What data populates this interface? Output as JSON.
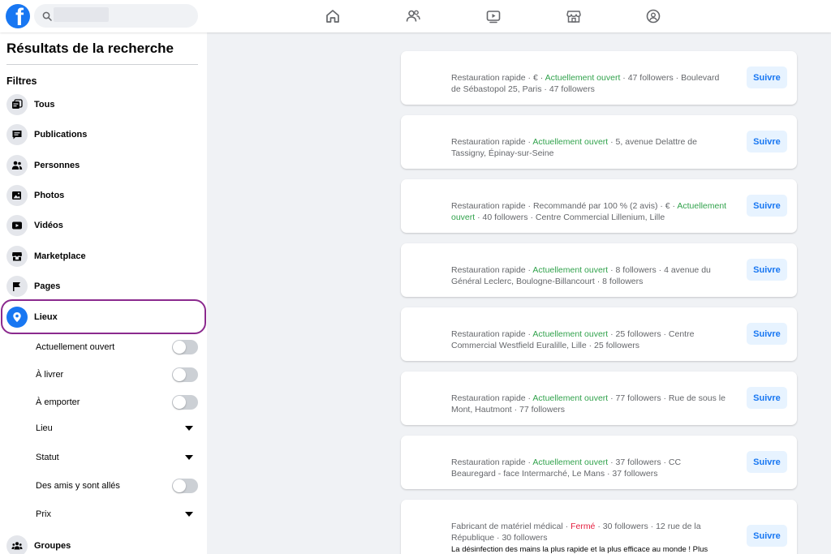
{
  "topbar": {
    "logo_letter": "f",
    "search": {
      "placeholder": "",
      "value": ""
    },
    "nav_icons": [
      "home-icon",
      "friends-icon",
      "watch-icon",
      "marketplace-icon",
      "groups-icon"
    ]
  },
  "sidebar": {
    "title": "Résultats de la recherche",
    "filters_title": "Filtres",
    "items": [
      {
        "label": "Tous",
        "icon": "all-icon"
      },
      {
        "label": "Publications",
        "icon": "posts-icon"
      },
      {
        "label": "Personnes",
        "icon": "people-icon"
      },
      {
        "label": "Photos",
        "icon": "photos-icon"
      },
      {
        "label": "Vidéos",
        "icon": "videos-icon"
      },
      {
        "label": "Marketplace",
        "icon": "marketplace-icon"
      },
      {
        "label": "Pages",
        "icon": "flag-icon"
      },
      {
        "label": "Lieux",
        "icon": "location-pin-icon",
        "active": true
      },
      {
        "label": "Groupes",
        "icon": "groups-icon"
      }
    ],
    "lieux_filters": [
      {
        "label": "Actuellement ouvert",
        "control": "toggle",
        "on": false
      },
      {
        "label": "À livrer",
        "control": "toggle",
        "on": false
      },
      {
        "label": "À emporter",
        "control": "toggle",
        "on": false
      },
      {
        "label": "Lieu",
        "control": "dropdown"
      },
      {
        "label": "Statut",
        "control": "dropdown"
      },
      {
        "label": "Des amis y sont allés",
        "control": "toggle",
        "on": false
      },
      {
        "label": "Prix",
        "control": "dropdown"
      }
    ]
  },
  "results": {
    "follow_label": "Suivre",
    "cards": [
      {
        "pre": "Restauration rapide · € · ",
        "status": "Actuellement ouvert",
        "post": " · 47 followers · Boulevard",
        "line2": "de Sébastopol 25, Paris · 47 followers"
      },
      {
        "pre": "Restauration rapide · ",
        "status": "Actuellement ouvert",
        "post": " · 5, avenue Delattre de",
        "line2": "Tassigny, Épinay-sur-Seine"
      },
      {
        "pre": "Restauration rapide · Recommandé par 100 % (2 avis) · € · ",
        "status": "Actuellement",
        "post": "",
        "line2_status": "ouvert",
        "line2": " · 40 followers · Centre Commercial Lillenium, Lille"
      },
      {
        "pre": "Restauration rapide · ",
        "status": "Actuellement ouvert",
        "post": " · 8 followers · 4 avenue du",
        "line2": "Général Leclerc, Boulogne-Billancourt · 8 followers"
      },
      {
        "pre": "Restauration rapide · ",
        "status": "Actuellement ouvert",
        "post": " · 25 followers · Centre",
        "line2": "Commercial Westfield Euralille, Lille · 25 followers"
      },
      {
        "pre": "Restauration rapide · ",
        "status": "Actuellement ouvert",
        "post": " · 77 followers · Rue de sous le",
        "line2": "Mont, Hautmont · 77 followers"
      },
      {
        "pre": "Restauration rapide · ",
        "status": "Actuellement ouvert",
        "post": " · 37 followers · CC",
        "line2": "Beauregard - face Intermarché, Le Mans · 37 followers"
      },
      {
        "pre": "Fabricant de matériel médical · ",
        "status": "Fermé",
        "closed": true,
        "post": " · 30 followers · 12 rue de la",
        "line2": "République · 30 followers",
        "extra": "La désinfection des mains la plus rapide et la plus efficace au monde ! Plus"
      }
    ]
  },
  "colors": {
    "brand": "#1877f2",
    "open": "#31a24c",
    "closed": "#e41e3f",
    "highlight_ring": "#8b2a8e"
  }
}
